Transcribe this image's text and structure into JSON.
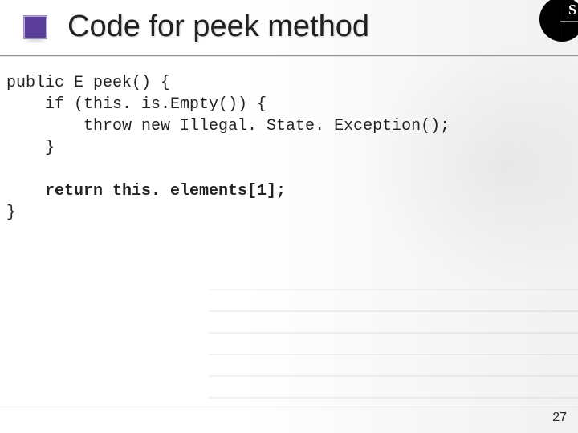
{
  "slide": {
    "title": "Code for peek method",
    "logo_letter": "S",
    "page_number": "27",
    "accent_color": "#5a3e99"
  },
  "code": {
    "l1": "public E peek() {",
    "l2": "    if (this. is.Empty()) {",
    "l3": "        throw new Illegal. State. Exception();",
    "l4": "    }",
    "l5": "",
    "l6_bold": "    return this. elements[1];",
    "l7": "}"
  }
}
